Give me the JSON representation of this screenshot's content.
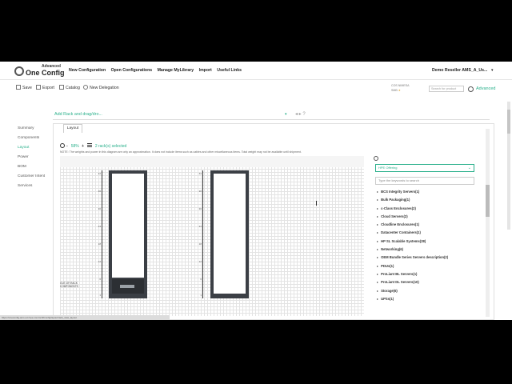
{
  "brand": {
    "tag": "Advanced",
    "name": "One Config"
  },
  "nav": [
    "New Configuration",
    "Open Configurations",
    "Manage MyLibrary",
    "Import",
    "Useful Links"
  ],
  "user": "Demo Reseller AMS_A_Us...",
  "toolbar": {
    "save": "Save",
    "export": "Export",
    "catalog": "Catalog",
    "delegation": "New Delegation"
  },
  "status": {
    "line1": "COS",
    "line1_tag": "NIMESA",
    "line2": "SMB"
  },
  "search": {
    "placeholder": "Search for product"
  },
  "advanced_label": "Advanced",
  "sidebar": [
    "Summary",
    "Components",
    "Layout",
    "Power",
    "BOM",
    "Customer Intent",
    "Services"
  ],
  "sidebar_active": "Layout",
  "rack_header": {
    "title": "Add Rack and drag/dro...",
    "caret": "▾",
    "nav": "◂  ▸   ?"
  },
  "tab": "Layout",
  "zoom": {
    "minus": "−",
    "percent": "58%",
    "plus": "+",
    "selected": "2 rack(s) selected"
  },
  "note": "NOTE: The weights and power in this diagram are only an approximation. It does not include items such as cables and other miscellaneous items. Total weight may not be available until shipment.",
  "rack_label": "OUT-OF-RACK\nCOMPONENTS",
  "ruler_ticks": [
    "42",
    "36",
    "30",
    "24",
    "18",
    "12",
    "6",
    "1"
  ],
  "catalog": {
    "dropdown": "HPE Offering",
    "search_placeholder": "Type the keywords to search",
    "categories": [
      "BCS Integrity Servers(1)",
      "Bulk Packaging(1)",
      "c-Class Enclosures(2)",
      "Cloud Servers(2)",
      "Cloudline Enclosures(1)",
      "Datacenter Containers(1)",
      "HP SL Scalable Systems(28)",
      "Networking(6)",
      "OEM Bundle Series Servers description(2)",
      "PDUs(1)",
      "ProLiant BL Servers(1)",
      "ProLiant DL Servers(10)",
      "Storage(6)",
      "UPSs(1)"
    ]
  },
  "statusbar": "https://oneconfig-ams.ext.hpe.com/oc/#/config/layout/rack_view_layout"
}
